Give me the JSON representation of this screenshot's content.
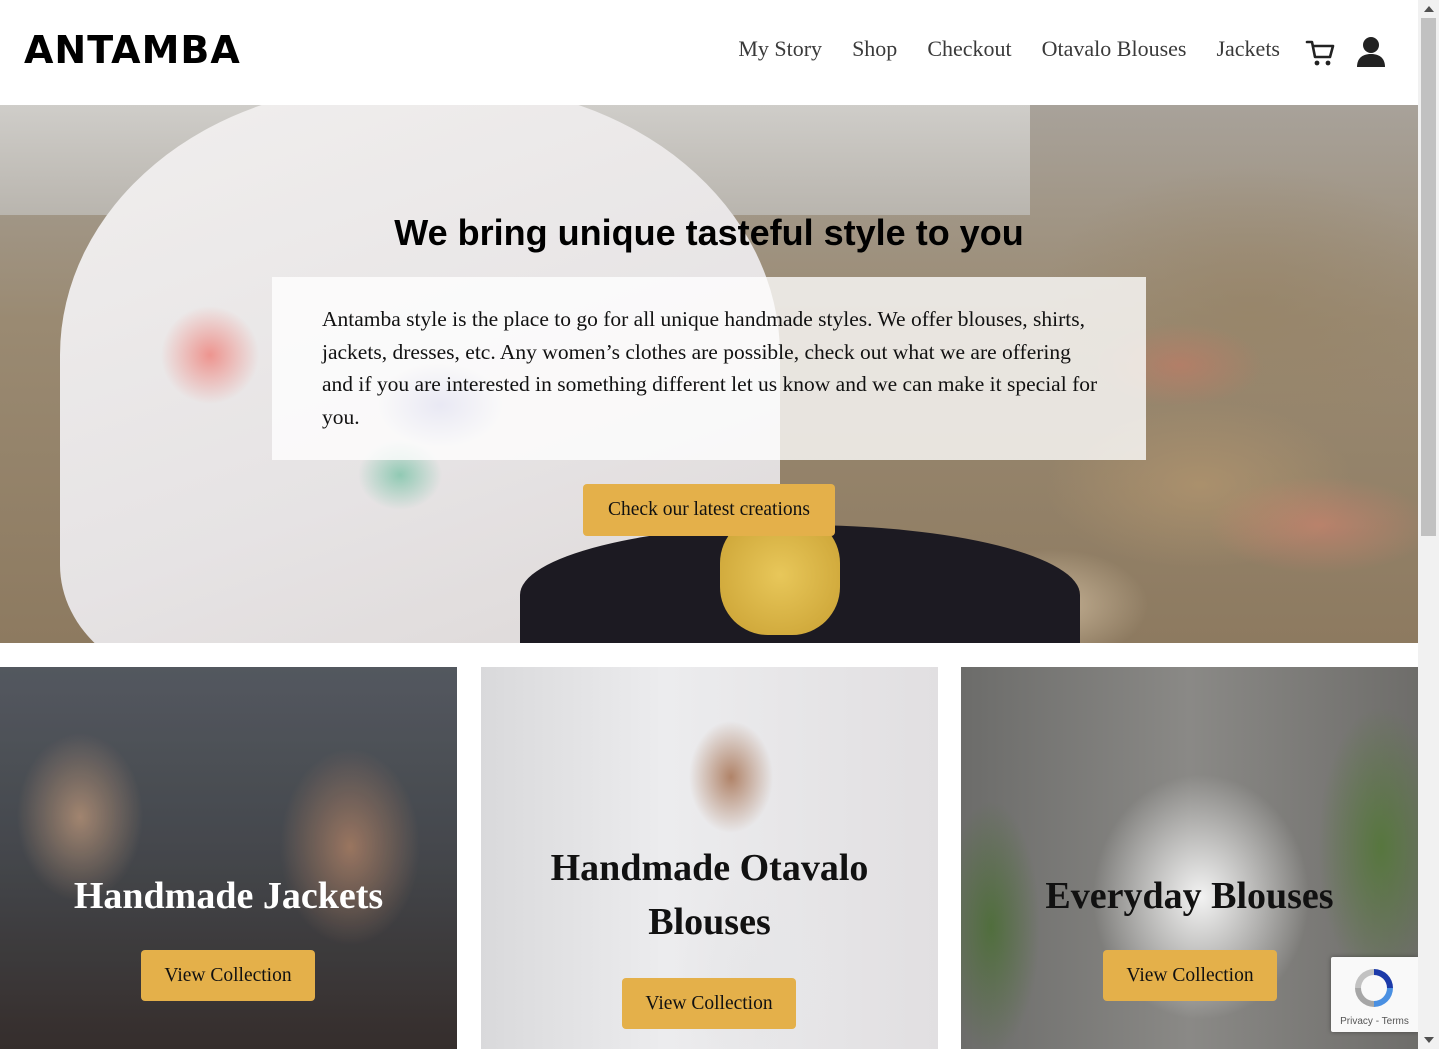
{
  "header": {
    "logo": "ANTAMBA",
    "nav": [
      "My Story",
      "Shop",
      "Checkout",
      "Otavalo Blouses",
      "Jackets"
    ],
    "cart_icon": "cart-icon",
    "account_icon": "user-icon"
  },
  "hero": {
    "title": "We bring unique tasteful style to you",
    "text": "Antamba style is the place to go for all unique handmade styles. We offer blouses, shirts, jackets, dresses, etc. Any women’s clothes are possible, check out what we are offering and if you are interested in something different let us know and we can make it special for you.",
    "button": "Check our latest creations"
  },
  "collections": [
    {
      "title": "Handmade Jackets",
      "button": "View Collection"
    },
    {
      "title": "Handmade Otavalo Blouses",
      "button": "View Collection"
    },
    {
      "title": "Everyday Blouses",
      "button": "View Collection"
    }
  ],
  "recaptcha": {
    "privacy": "Privacy",
    "separator": "-",
    "terms": "Terms"
  },
  "colors": {
    "accent": "#e4b04a",
    "text": "#1a1a1a"
  }
}
